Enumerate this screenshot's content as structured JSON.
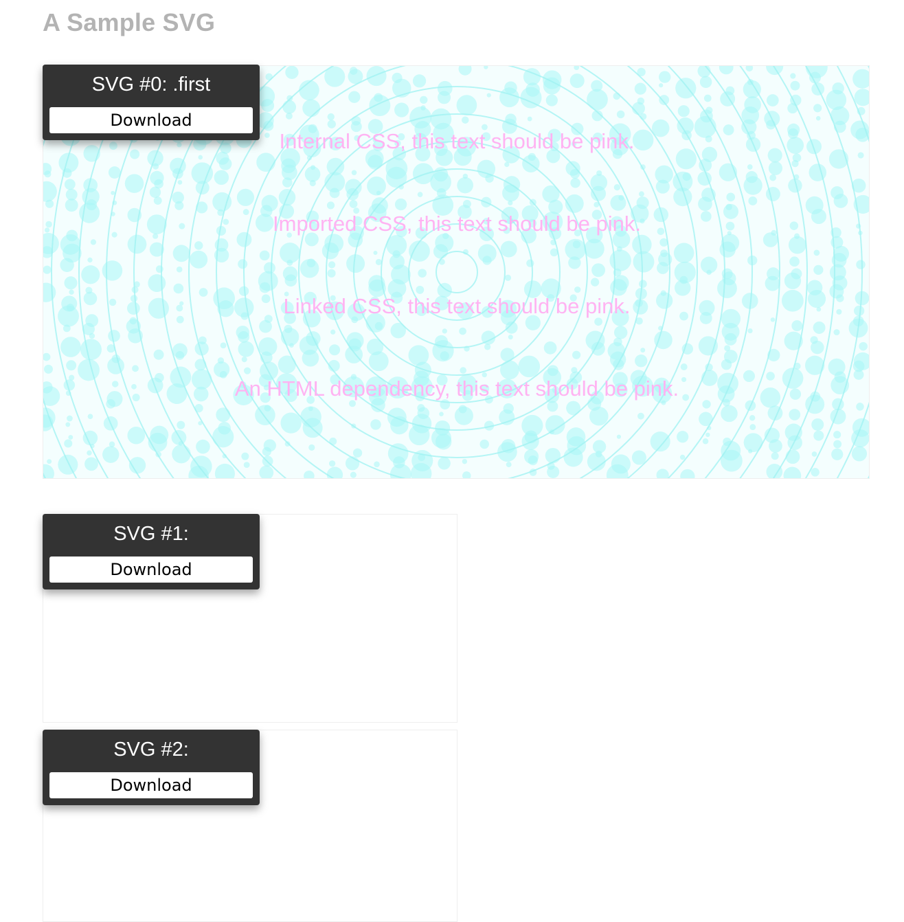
{
  "page": {
    "title": "A Sample SVG"
  },
  "svgs": [
    {
      "toolbar_title": "SVG #0: .first",
      "download_label": "Download",
      "text_lines": [
        "Internal CSS, this text should be pink.",
        "Imported CSS, this text should be pink.",
        "Linked CSS, this text should be pink.",
        "An HTML dependency, this text should be pink."
      ]
    },
    {
      "toolbar_title": "SVG #1:",
      "download_label": "Download"
    },
    {
      "toolbar_title": "SVG #2:",
      "download_label": "Download"
    }
  ],
  "colors": {
    "title_gray": "#b3b3b3",
    "toolbar_bg": "#333333",
    "text_pink": "#ffb3f2",
    "art_cyan": "#aaf5f5"
  }
}
